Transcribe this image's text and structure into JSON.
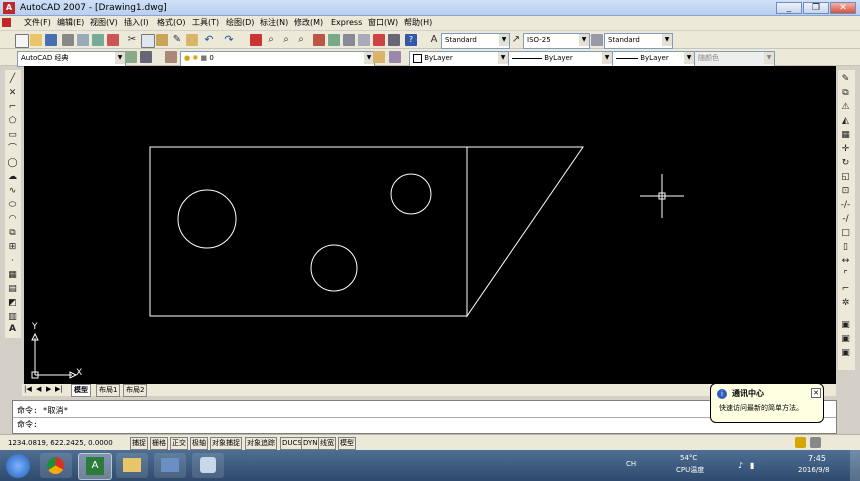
{
  "window": {
    "title": "AutoCAD 2007 - [Drawing1.dwg]",
    "min": "_",
    "restore": "❐",
    "close": "✕"
  },
  "menu": [
    "文件(F)",
    "编辑(E)",
    "视图(V)",
    "插入(I)",
    "格式(O)",
    "工具(T)",
    "绘图(D)",
    "标注(N)",
    "修改(M)",
    "Express",
    "窗口(W)",
    "帮助(H)"
  ],
  "styles": {
    "text_style": "Standard",
    "dim_style": "ISO-25",
    "table_style": "Standard"
  },
  "workspace": "AutoCAD 经典",
  "layer": "0",
  "properties": {
    "color": "ByLayer",
    "linetype": "ByLayer",
    "lineweight": "ByLayer",
    "plotstyle": "随颜色"
  },
  "ucs": {
    "y": "Y",
    "x": "X"
  },
  "tabs": {
    "model": "模型",
    "layout1": "布局1",
    "layout2": "布局2"
  },
  "command": {
    "line1": "命令: *取消*",
    "line2": "命令:"
  },
  "status": {
    "coords": "1234.0819, 622.2425, 0.0000",
    "buttons": [
      "捕捉",
      "栅格",
      "正交",
      "极轴",
      "对象捕捉",
      "对象追踪",
      "DUCS",
      "DYN",
      "线宽",
      "模型"
    ]
  },
  "balloon": {
    "title": "通讯中心",
    "text": "快速访问最新的简单方法。"
  },
  "tray": {
    "temp": "54°C",
    "cpu": "CPU温度",
    "lang": "CH",
    "time": "7:45",
    "date": "2016/9/8"
  },
  "colors": {
    "canvas": "#000000",
    "lines": "#ffffff",
    "title": "#bcd2f0"
  }
}
